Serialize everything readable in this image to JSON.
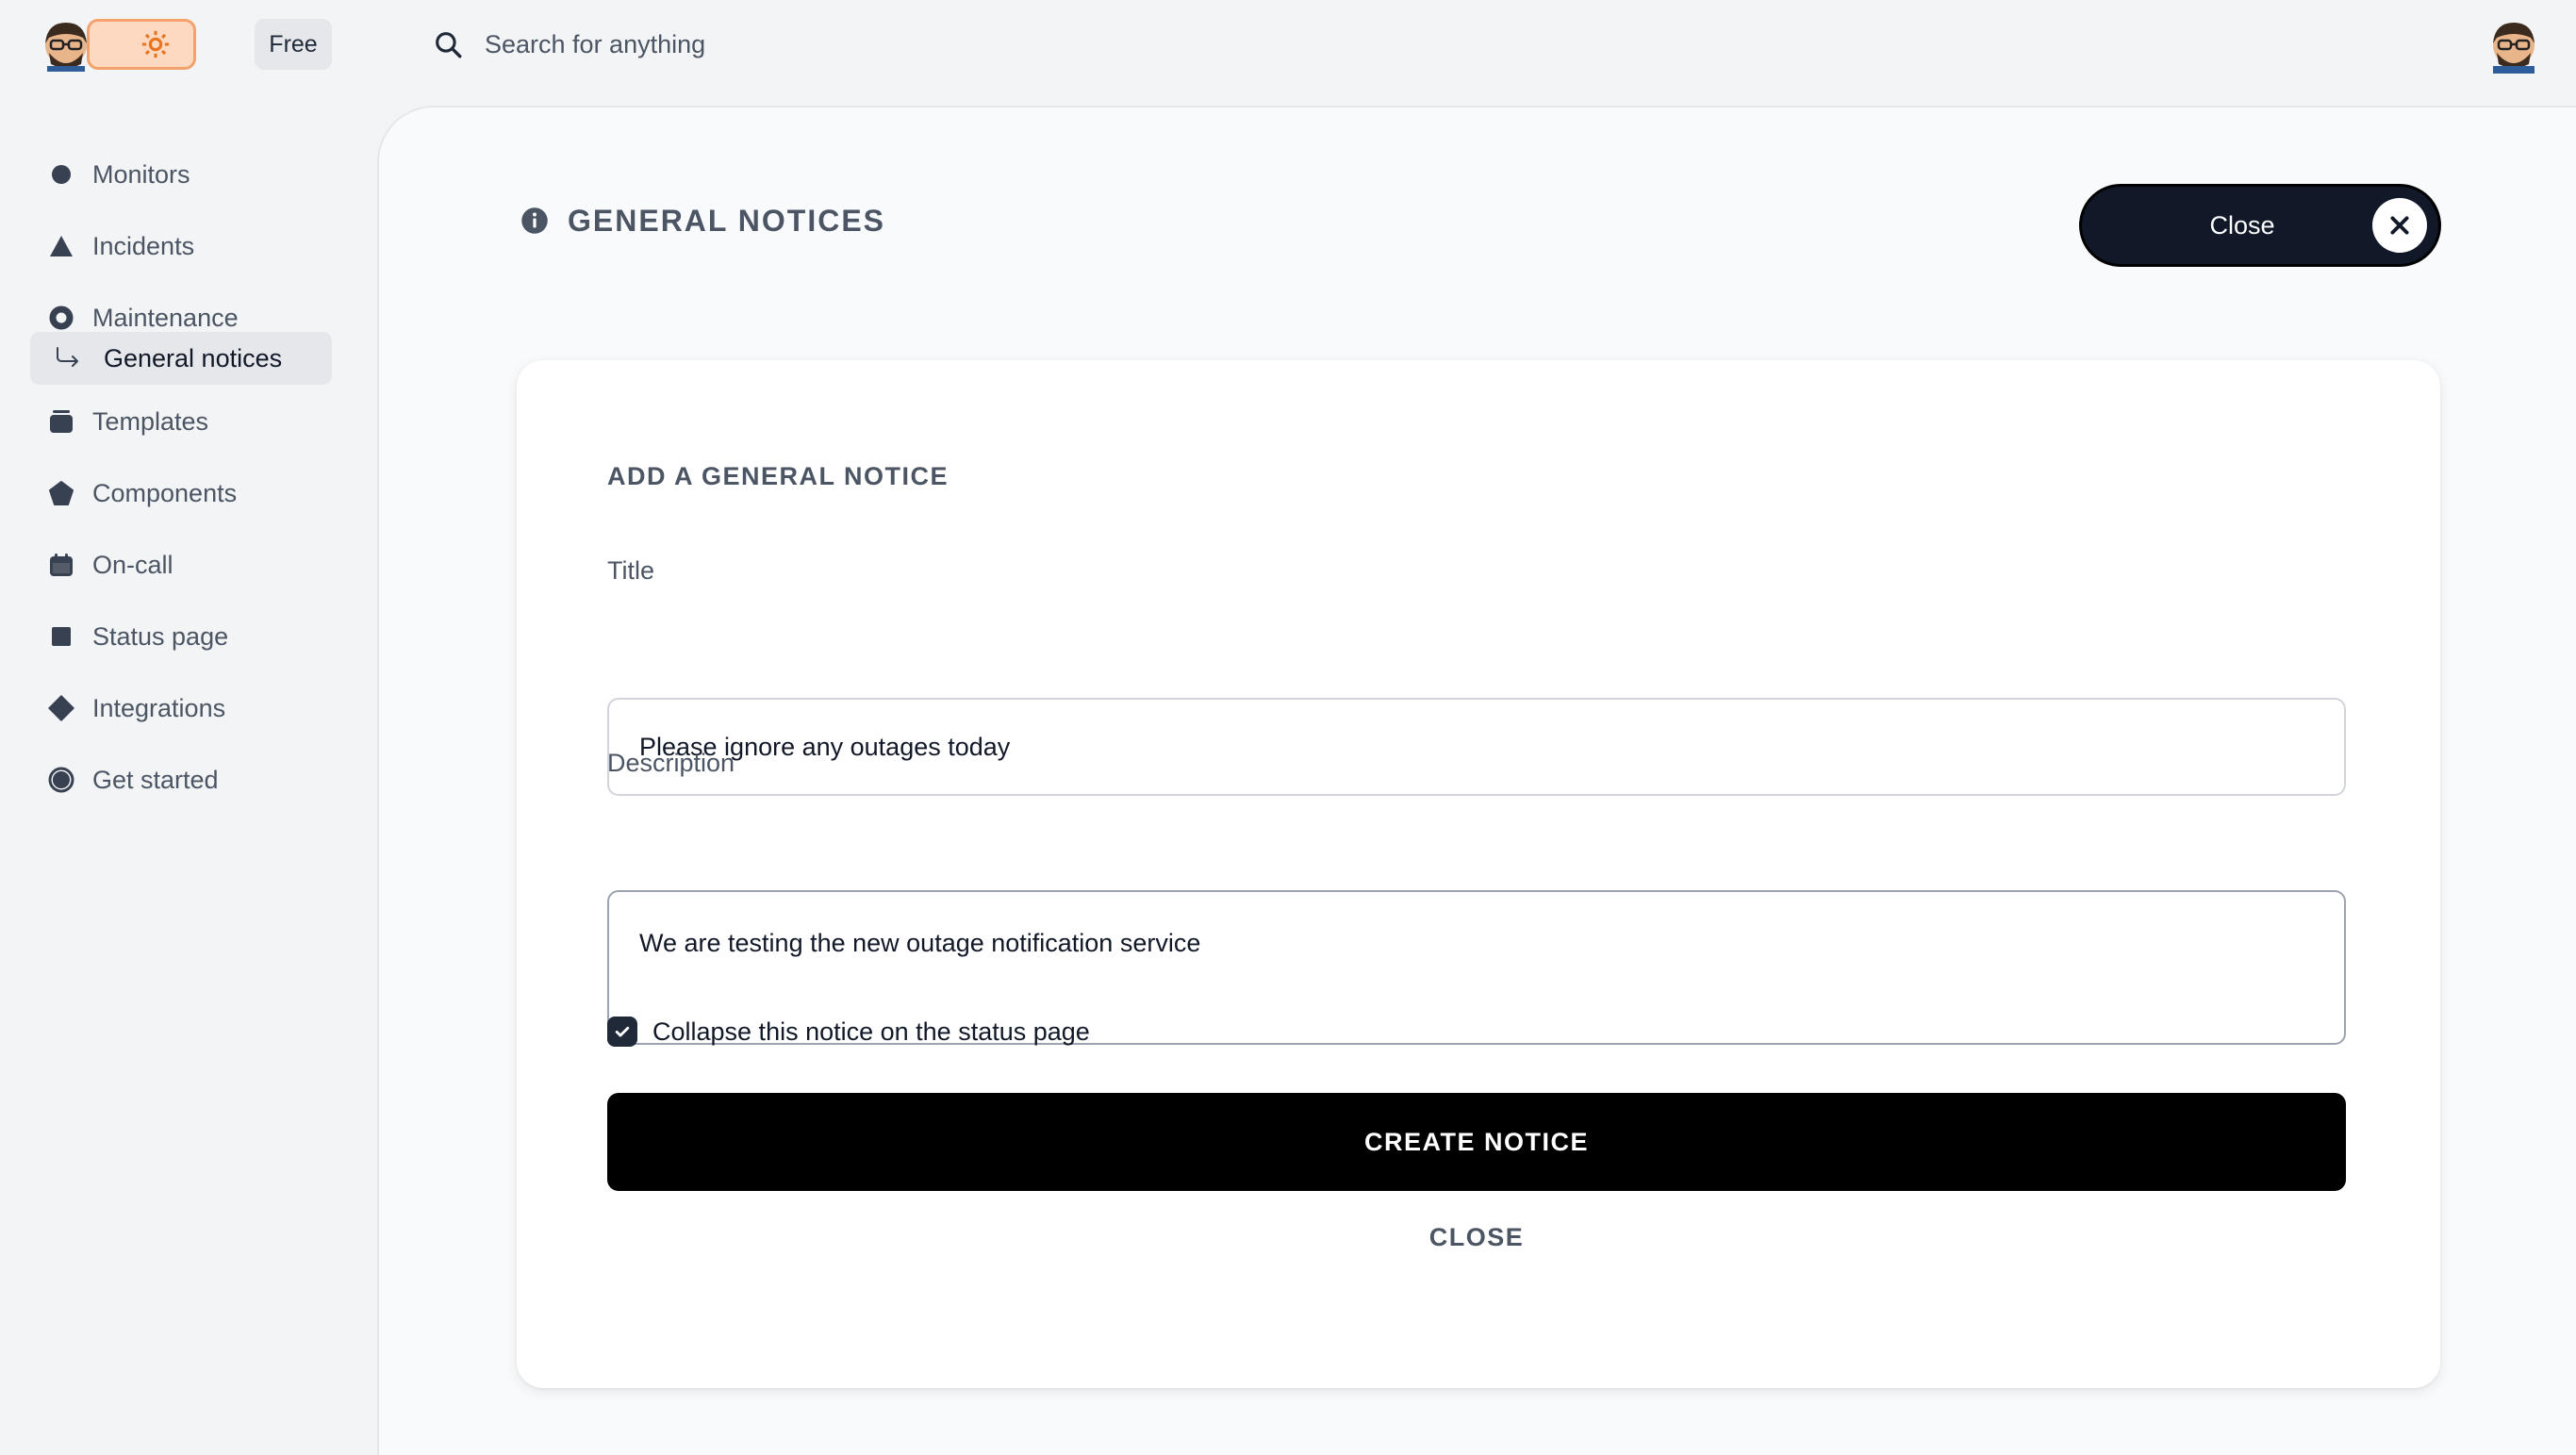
{
  "topbar": {
    "plan_badge": "Free",
    "search_placeholder": "Search for anything"
  },
  "sidebar": {
    "items": [
      {
        "label": "Monitors",
        "icon": "circle-icon"
      },
      {
        "label": "Incidents",
        "icon": "triangle-icon"
      },
      {
        "label": "Maintenance",
        "icon": "ring-icon"
      },
      {
        "label": "General notices",
        "icon": "sub-arrow-icon",
        "active": true
      },
      {
        "label": "Templates",
        "icon": "card-stack-icon"
      },
      {
        "label": "Components",
        "icon": "pentagon-icon"
      },
      {
        "label": "On-call",
        "icon": "calendar-icon"
      },
      {
        "label": "Status page",
        "icon": "square-icon"
      },
      {
        "label": "Integrations",
        "icon": "diamond-icon"
      },
      {
        "label": "Get started",
        "icon": "half-circle-icon"
      }
    ]
  },
  "main": {
    "title": "GENERAL NOTICES",
    "close_label": "Close"
  },
  "form": {
    "heading": "ADD A GENERAL NOTICE",
    "title_label": "Title",
    "title_value": "Please ignore any outages today",
    "description_label": "Description",
    "description_value": "We are testing the new outage notification service",
    "collapse_label": "Collapse this notice on the status page",
    "collapse_checked": true,
    "create_label": "CREATE NOTICE",
    "close_label": "CLOSE"
  },
  "colors": {
    "accent_dark": "#111827",
    "logo_orange": "#f4a26b",
    "page_bg": "#f3f4f6"
  }
}
